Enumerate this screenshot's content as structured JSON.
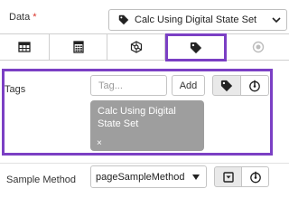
{
  "data_field": {
    "label": "Data",
    "required_mark": "*",
    "selected_value": "Calc Using Digital State Set",
    "icon": "tag-icon"
  },
  "tabs": [
    {
      "icon": "table-icon",
      "active": false
    },
    {
      "icon": "calculator-icon",
      "active": false
    },
    {
      "icon": "network-icon",
      "active": false
    },
    {
      "icon": "tag-icon",
      "active": true
    },
    {
      "icon": "record-icon",
      "active": false,
      "disabled": true
    }
  ],
  "tags": {
    "label": "Tags",
    "input_placeholder": "Tag...",
    "add_label": "Add",
    "mode_buttons": [
      "tag-icon",
      "dial-icon"
    ],
    "chips": [
      {
        "text": "Calc Using Digital State Set",
        "remove": "×"
      }
    ]
  },
  "sample_method": {
    "label": "Sample Method",
    "selected_value": "pageSampleMethod",
    "mode_buttons": [
      "dropdown-box-icon",
      "dial-icon"
    ]
  },
  "colors": {
    "highlight": "#7b3fc4",
    "chip_bg": "#9e9e9e",
    "required": "#d9342b"
  }
}
